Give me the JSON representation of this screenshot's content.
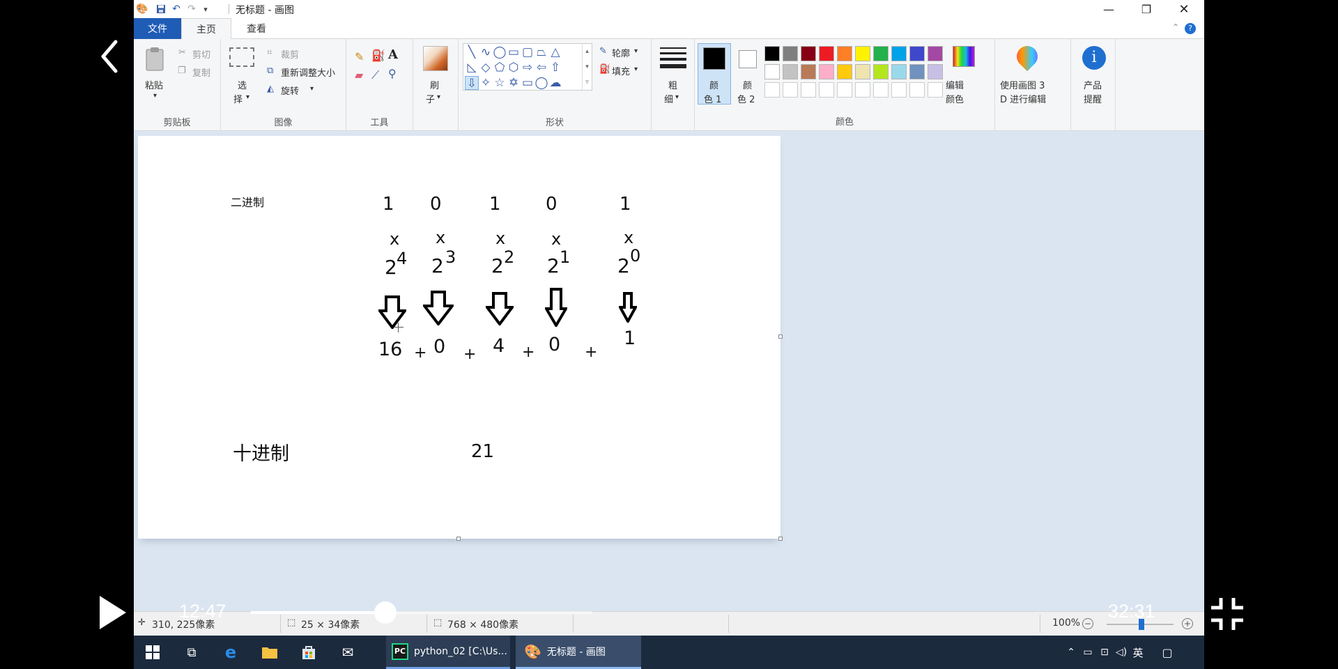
{
  "window": {
    "title": "无标题 - 画图",
    "quick_access": [
      "save-icon",
      "undo-icon",
      "redo-icon",
      "customize-icon"
    ],
    "controls": [
      "minimize",
      "restore",
      "close"
    ]
  },
  "tabs": [
    {
      "label": "文件",
      "active": false
    },
    {
      "label": "主页",
      "active": true
    },
    {
      "label": "查看",
      "active": false
    }
  ],
  "ribbon": {
    "clipboard": {
      "group_label": "剪贴板",
      "paste": "粘贴",
      "cut": "剪切",
      "copy": "复制"
    },
    "image": {
      "group_label": "图像",
      "select_line1": "选",
      "select_line2": "择",
      "crop": "裁剪",
      "resize": "重新调整大小",
      "rotate": "旋转"
    },
    "tools": {
      "group_label": "工具"
    },
    "brush": {
      "line1": "刷",
      "line2": "子"
    },
    "shapes": {
      "group_label": "形状",
      "outline": "轮廓",
      "fill": "填充"
    },
    "size": {
      "line1": "粗",
      "line2": "细"
    },
    "colors": {
      "group_label": "颜色",
      "color1_line1": "颜",
      "color1_line2": "色 1",
      "color2_line1": "颜",
      "color2_line2": "色 2",
      "edit_line1": "编辑",
      "edit_line2": "颜色",
      "paint3d_line1": "使用画图 3",
      "paint3d_line2": "D 进行编辑",
      "alert_line1": "产品",
      "alert_line2": "提醒",
      "palette_row1": [
        "#000000",
        "#7f7f7f",
        "#880015",
        "#ed1c24",
        "#ff7f27",
        "#fff200",
        "#22b14c",
        "#00a2e8",
        "#3f48cc",
        "#a349a4"
      ],
      "palette_row2": [
        "#ffffff",
        "#c3c3c3",
        "#b97a57",
        "#ffaec9",
        "#ffc90e",
        "#efe4b0",
        "#b5e61d",
        "#99d9ea",
        "#7092be",
        "#c8bfe7"
      ]
    }
  },
  "canvas": {
    "binary_label": "二进制",
    "decimal_label": "十进制",
    "decimal_value": "21",
    "bits": [
      "1",
      "0",
      "1",
      "0",
      "1"
    ],
    "times": [
      "x",
      "x",
      "x",
      "x",
      "x"
    ],
    "bases": [
      "2",
      "2",
      "2",
      "2",
      "2"
    ],
    "exponents": [
      "4",
      "3",
      "2",
      "1",
      "0"
    ],
    "terms": [
      "16",
      "0",
      "4",
      "0",
      "1"
    ],
    "plus": [
      "+",
      "+",
      "+",
      "+"
    ]
  },
  "statusbar": {
    "cursor_pos": "310, 225像素",
    "selection_size": "25 × 34像素",
    "canvas_size": "768 × 480像素",
    "zoom": "100%"
  },
  "taskbar": {
    "apps": [
      {
        "label": "python_02 [C:\\Us..."
      },
      {
        "label": "无标题 - 画图"
      }
    ],
    "ime": "英"
  },
  "video": {
    "current_time": "12:47",
    "total_time": "32:31",
    "progress": 0.393
  }
}
